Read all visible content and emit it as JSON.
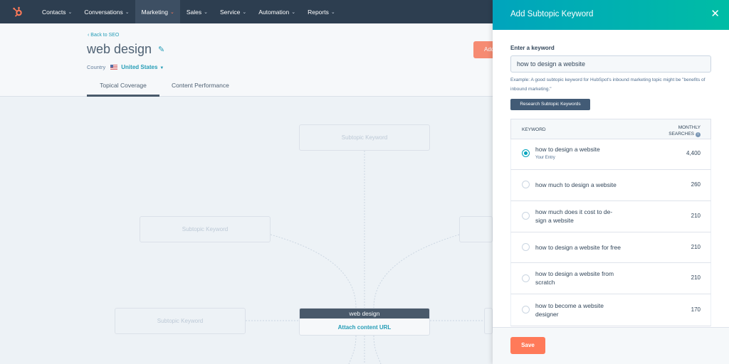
{
  "nav": {
    "items": [
      {
        "label": "Contacts",
        "active": false
      },
      {
        "label": "Conversations",
        "active": false
      },
      {
        "label": "Marketing",
        "active": true
      },
      {
        "label": "Sales",
        "active": false
      },
      {
        "label": "Service",
        "active": false
      },
      {
        "label": "Automation",
        "active": false
      },
      {
        "label": "Reports",
        "active": false
      }
    ]
  },
  "header": {
    "back_label": "Back to SEO",
    "title": "web design",
    "country_label": "Country",
    "country_value": "United States",
    "action_button_label": "Add",
    "tabs": [
      {
        "label": "Topical Coverage",
        "active": true
      },
      {
        "label": "Content Performance",
        "active": false
      }
    ]
  },
  "canvas": {
    "subtopic_placeholder": "Subtopic Keyword",
    "center_topic": "web design",
    "attach_label": "Attach content URL"
  },
  "panel": {
    "title": "Add Subtopic Keyword",
    "input_label": "Enter a keyword",
    "input_value": "how to design a website",
    "hint": "Example: A good subtopic keyword for HubSpot's inbound marketing topic might be \"benefits of inbound marketing.\"",
    "research_button": "Research Subtopic Keywords",
    "col_keyword": "KEYWORD",
    "col_searches_1": "MONTHLY",
    "col_searches_2": "SEARCHES",
    "rows": [
      {
        "keyword": "how to design a website",
        "sub": "Your Entry",
        "volume": "4,400",
        "selected": true
      },
      {
        "keyword": "how much to design a website",
        "volume": "260",
        "selected": false
      },
      {
        "keyword": "how much does it cost to de-\nsign a website",
        "volume": "210",
        "selected": false
      },
      {
        "keyword": "how to design a website for free",
        "volume": "210",
        "selected": false
      },
      {
        "keyword": "how to design a website from\nscratch",
        "volume": "210",
        "selected": false
      },
      {
        "keyword": "how to become a website\ndesigner",
        "volume": "170",
        "selected": false
      }
    ],
    "save_label": "Save"
  },
  "colors": {
    "nav_bg": "#2d3e50",
    "accent_orange": "#ff7a59",
    "accent_teal": "#00a4bd",
    "link": "#0091ae"
  }
}
